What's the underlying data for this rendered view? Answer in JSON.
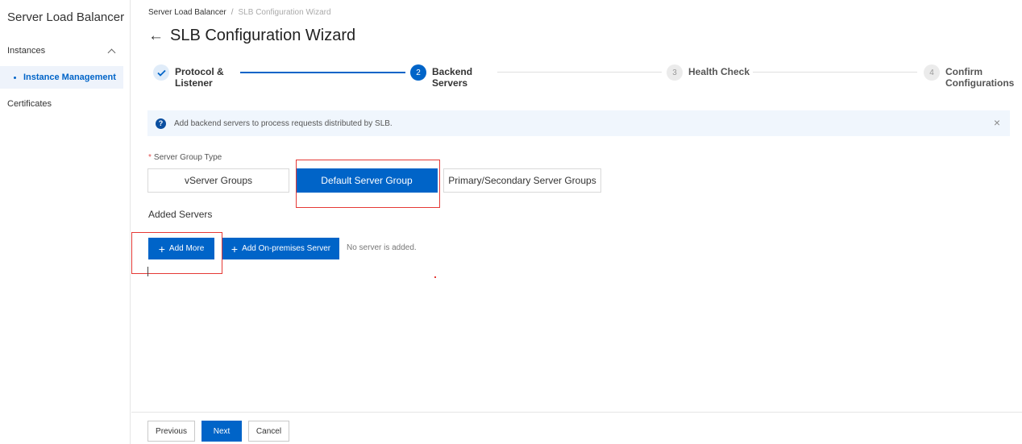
{
  "sidebar": {
    "title": "Server Load Balancer",
    "group": {
      "label": "Instances"
    },
    "active_item": {
      "label": "Instance Management"
    },
    "items": [
      {
        "label": "Certificates"
      }
    ]
  },
  "breadcrumb": {
    "root": "Server Load Balancer",
    "separator": "/",
    "current": "SLB Configuration Wizard"
  },
  "header": {
    "back_icon": "←",
    "title": "SLB Configuration Wizard"
  },
  "steps": [
    {
      "label_line1": "Protocol &",
      "label_line2": "Listener",
      "status": "done"
    },
    {
      "number": "2",
      "label_line1": "Backend",
      "label_line2": "Servers",
      "status": "active"
    },
    {
      "number": "3",
      "label_line1": "Health Check",
      "label_line2": "",
      "status": "todo"
    },
    {
      "number": "4",
      "label_line1": "Confirm",
      "label_line2": "Configurations",
      "status": "todo"
    }
  ],
  "banner": {
    "icon": "?",
    "text": "Add backend servers to process requests distributed by SLB.",
    "close": "×"
  },
  "server_group": {
    "required_mark": "*",
    "label": "Server Group Type",
    "options": [
      "vServer Groups",
      "Default Server Group",
      "Primary/Secondary Server Groups"
    ],
    "selected": "Default Server Group"
  },
  "added_servers": {
    "title": "Added Servers",
    "add_more": "Add More",
    "add_onprem": "Add On-premises Server",
    "empty_text": "No server is added."
  },
  "footer": {
    "previous": "Previous",
    "next": "Next",
    "cancel": "Cancel"
  },
  "colors": {
    "primary": "#0064c8",
    "highlight": "#e53935",
    "banner_bg": "#f0f6fd"
  }
}
